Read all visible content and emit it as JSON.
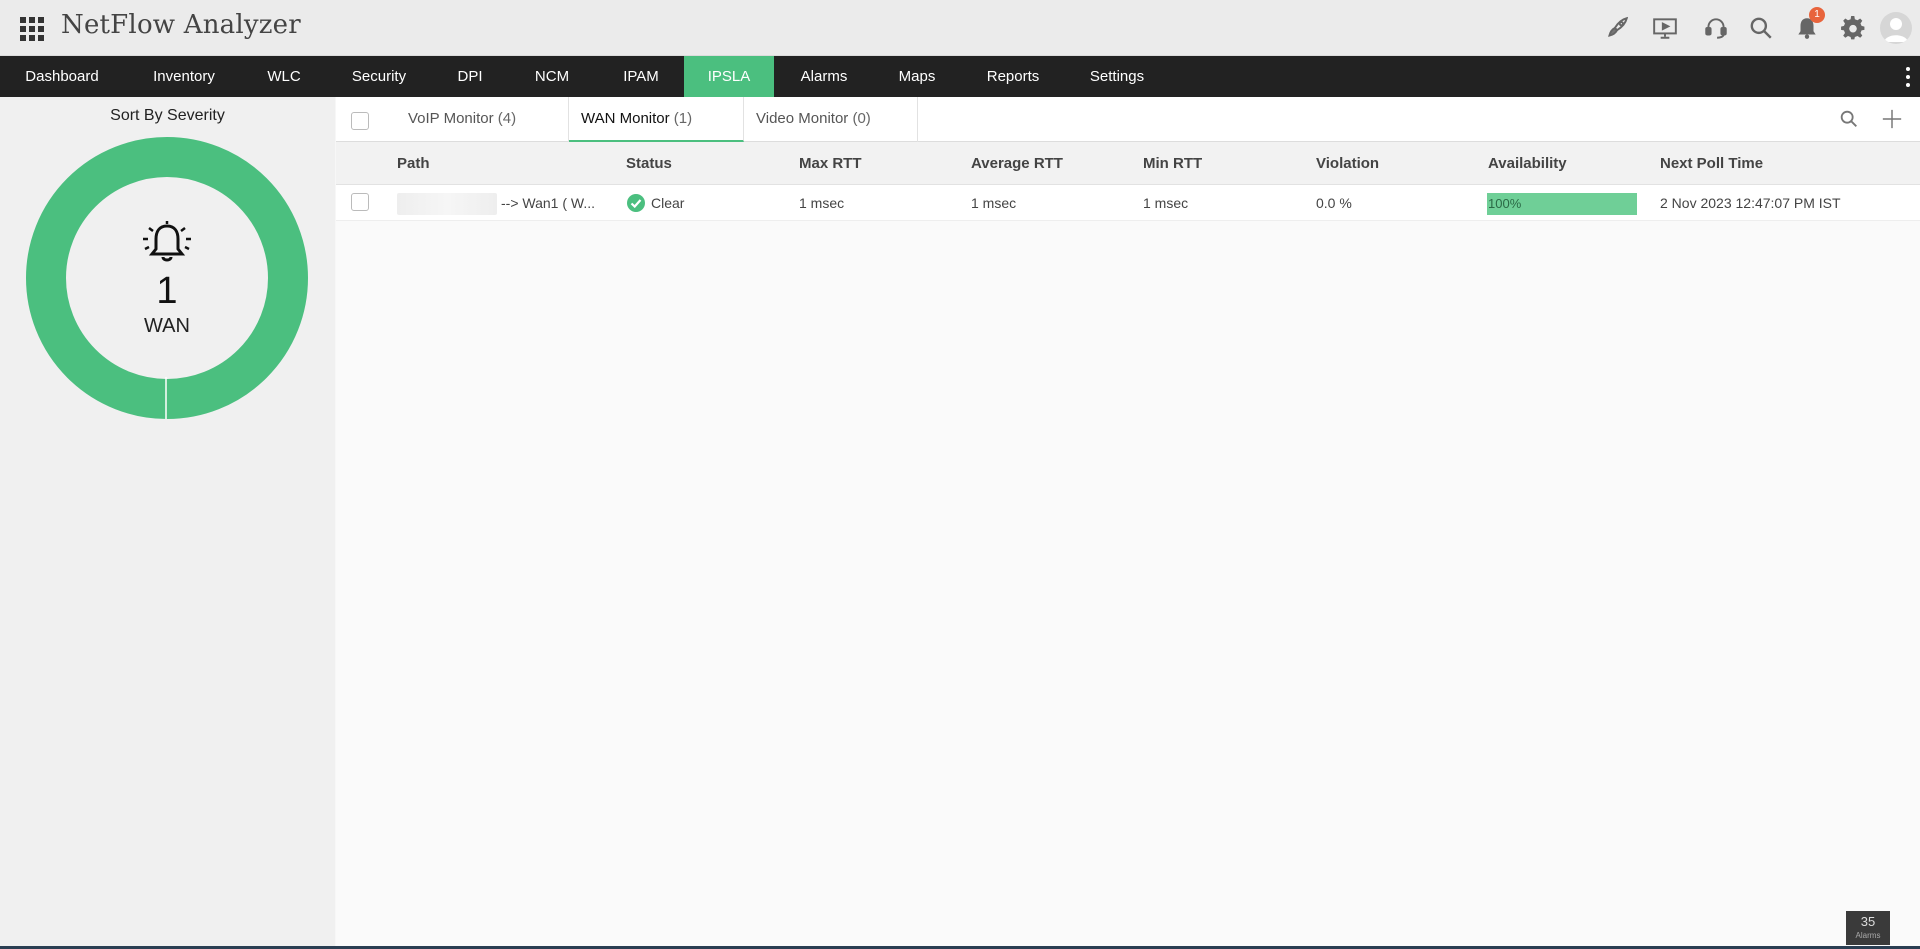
{
  "app": {
    "title": "NetFlow Analyzer"
  },
  "header": {
    "icons": [
      "rocket-icon",
      "presentation-icon",
      "headset-icon",
      "search-icon",
      "bell-icon",
      "gear-icon",
      "user-avatar"
    ],
    "notification_count": "1"
  },
  "nav": {
    "items": [
      {
        "label": "Dashboard"
      },
      {
        "label": "Inventory"
      },
      {
        "label": "WLC"
      },
      {
        "label": "Security"
      },
      {
        "label": "DPI"
      },
      {
        "label": "NCM"
      },
      {
        "label": "IPAM"
      },
      {
        "label": "IPSLA",
        "active": true
      },
      {
        "label": "Alarms"
      },
      {
        "label": "Maps"
      },
      {
        "label": "Reports"
      },
      {
        "label": "Settings"
      }
    ]
  },
  "left_panel": {
    "title": "Sort By Severity",
    "donut": {
      "count": "1",
      "label": "WAN",
      "color": "#4bbf7f"
    }
  },
  "tabs": [
    {
      "label": "VoIP Monitor",
      "count": "(4)"
    },
    {
      "label": "WAN Monitor",
      "count": "(1)",
      "active": true
    },
    {
      "label": "Video Monitor",
      "count": "(0)"
    }
  ],
  "table": {
    "columns": [
      "Path",
      "Status",
      "Max RTT",
      "Average RTT",
      "Min RTT",
      "Violation",
      "Availability",
      "Next Poll Time"
    ],
    "rows": [
      {
        "path": "--> Wan1 ( W...",
        "status": "Clear",
        "max_rtt": "1 msec",
        "avg_rtt": "1 msec",
        "min_rtt": "1 msec",
        "violation": "0.0 %",
        "availability": "100%",
        "availability_fraction": 1.0,
        "next_poll": "2 Nov 2023 12:47:07 PM IST"
      }
    ]
  },
  "footer": {
    "alarm_count": "35",
    "alarm_label": "Alarms"
  },
  "colors": {
    "accent": "#4bbf7f",
    "navbar": "#222222",
    "badge": "#e8643c"
  }
}
